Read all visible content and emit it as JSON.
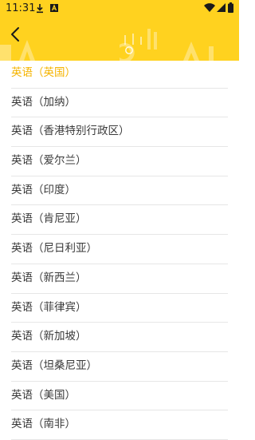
{
  "status_bar": {
    "time": "11:31",
    "icons": [
      "download-icon",
      "notification-app-icon",
      "wifi-icon",
      "signal-icon",
      "battery-icon"
    ]
  },
  "header": {
    "back_icon": "chevron-left-icon",
    "background_color": "#ffd21f"
  },
  "colors": {
    "selected_text": "#f5b400",
    "normal_text": "#3a3a3a",
    "divider": "#e6e6e6"
  },
  "languages": [
    {
      "label": "英语（英国）",
      "selected": true
    },
    {
      "label": "英语（加纳）",
      "selected": false
    },
    {
      "label": "英语（香港特别行政区）",
      "selected": false
    },
    {
      "label": "英语（爱尔兰）",
      "selected": false
    },
    {
      "label": "英语（印度）",
      "selected": false
    },
    {
      "label": "英语（肯尼亚）",
      "selected": false
    },
    {
      "label": "英语（尼日利亚）",
      "selected": false
    },
    {
      "label": "英语（新西兰）",
      "selected": false
    },
    {
      "label": "英语（菲律宾）",
      "selected": false
    },
    {
      "label": "英语（新加坡）",
      "selected": false
    },
    {
      "label": "英语（坦桑尼亚）",
      "selected": false
    },
    {
      "label": "英语（美国）",
      "selected": false
    },
    {
      "label": "英语（南非）",
      "selected": false
    }
  ]
}
